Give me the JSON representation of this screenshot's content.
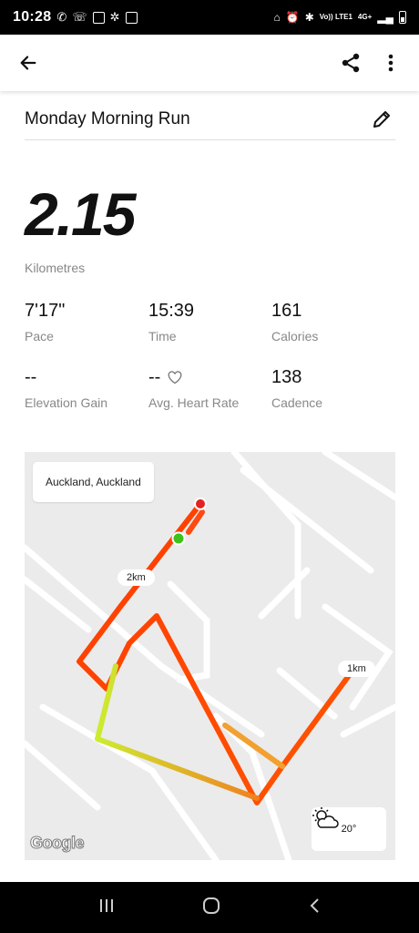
{
  "status_bar": {
    "time": "10:28",
    "network": "4G+",
    "lte": "Vo)) LTE1"
  },
  "app_bar": {
    "back_icon": "arrow-left-icon",
    "share_icon": "share-icon",
    "more_icon": "more-vertical-icon"
  },
  "activity": {
    "title": "Monday Morning Run",
    "distance": "2.15",
    "distance_unit": "Kilometres"
  },
  "stats": [
    {
      "value": "7'17\"",
      "label": "Pace"
    },
    {
      "value": "15:39",
      "label": "Time"
    },
    {
      "value": "161",
      "label": "Calories"
    },
    {
      "value": "--",
      "label": "Elevation Gain"
    },
    {
      "value": "--",
      "label": "Avg. Heart Rate"
    },
    {
      "value": "138",
      "label": "Cadence"
    }
  ],
  "map": {
    "location": "Auckland, Auckland",
    "markers": {
      "km1": "1km",
      "km2": "2km"
    },
    "weather_temp": "20°",
    "weather_icon": "partly-cloudy-icon",
    "attribution": "Google",
    "colors": {
      "route_fast": "#ff3b00",
      "route_slow": "#d4f03a",
      "start": "#3ec21a",
      "end": "#e52222"
    }
  }
}
